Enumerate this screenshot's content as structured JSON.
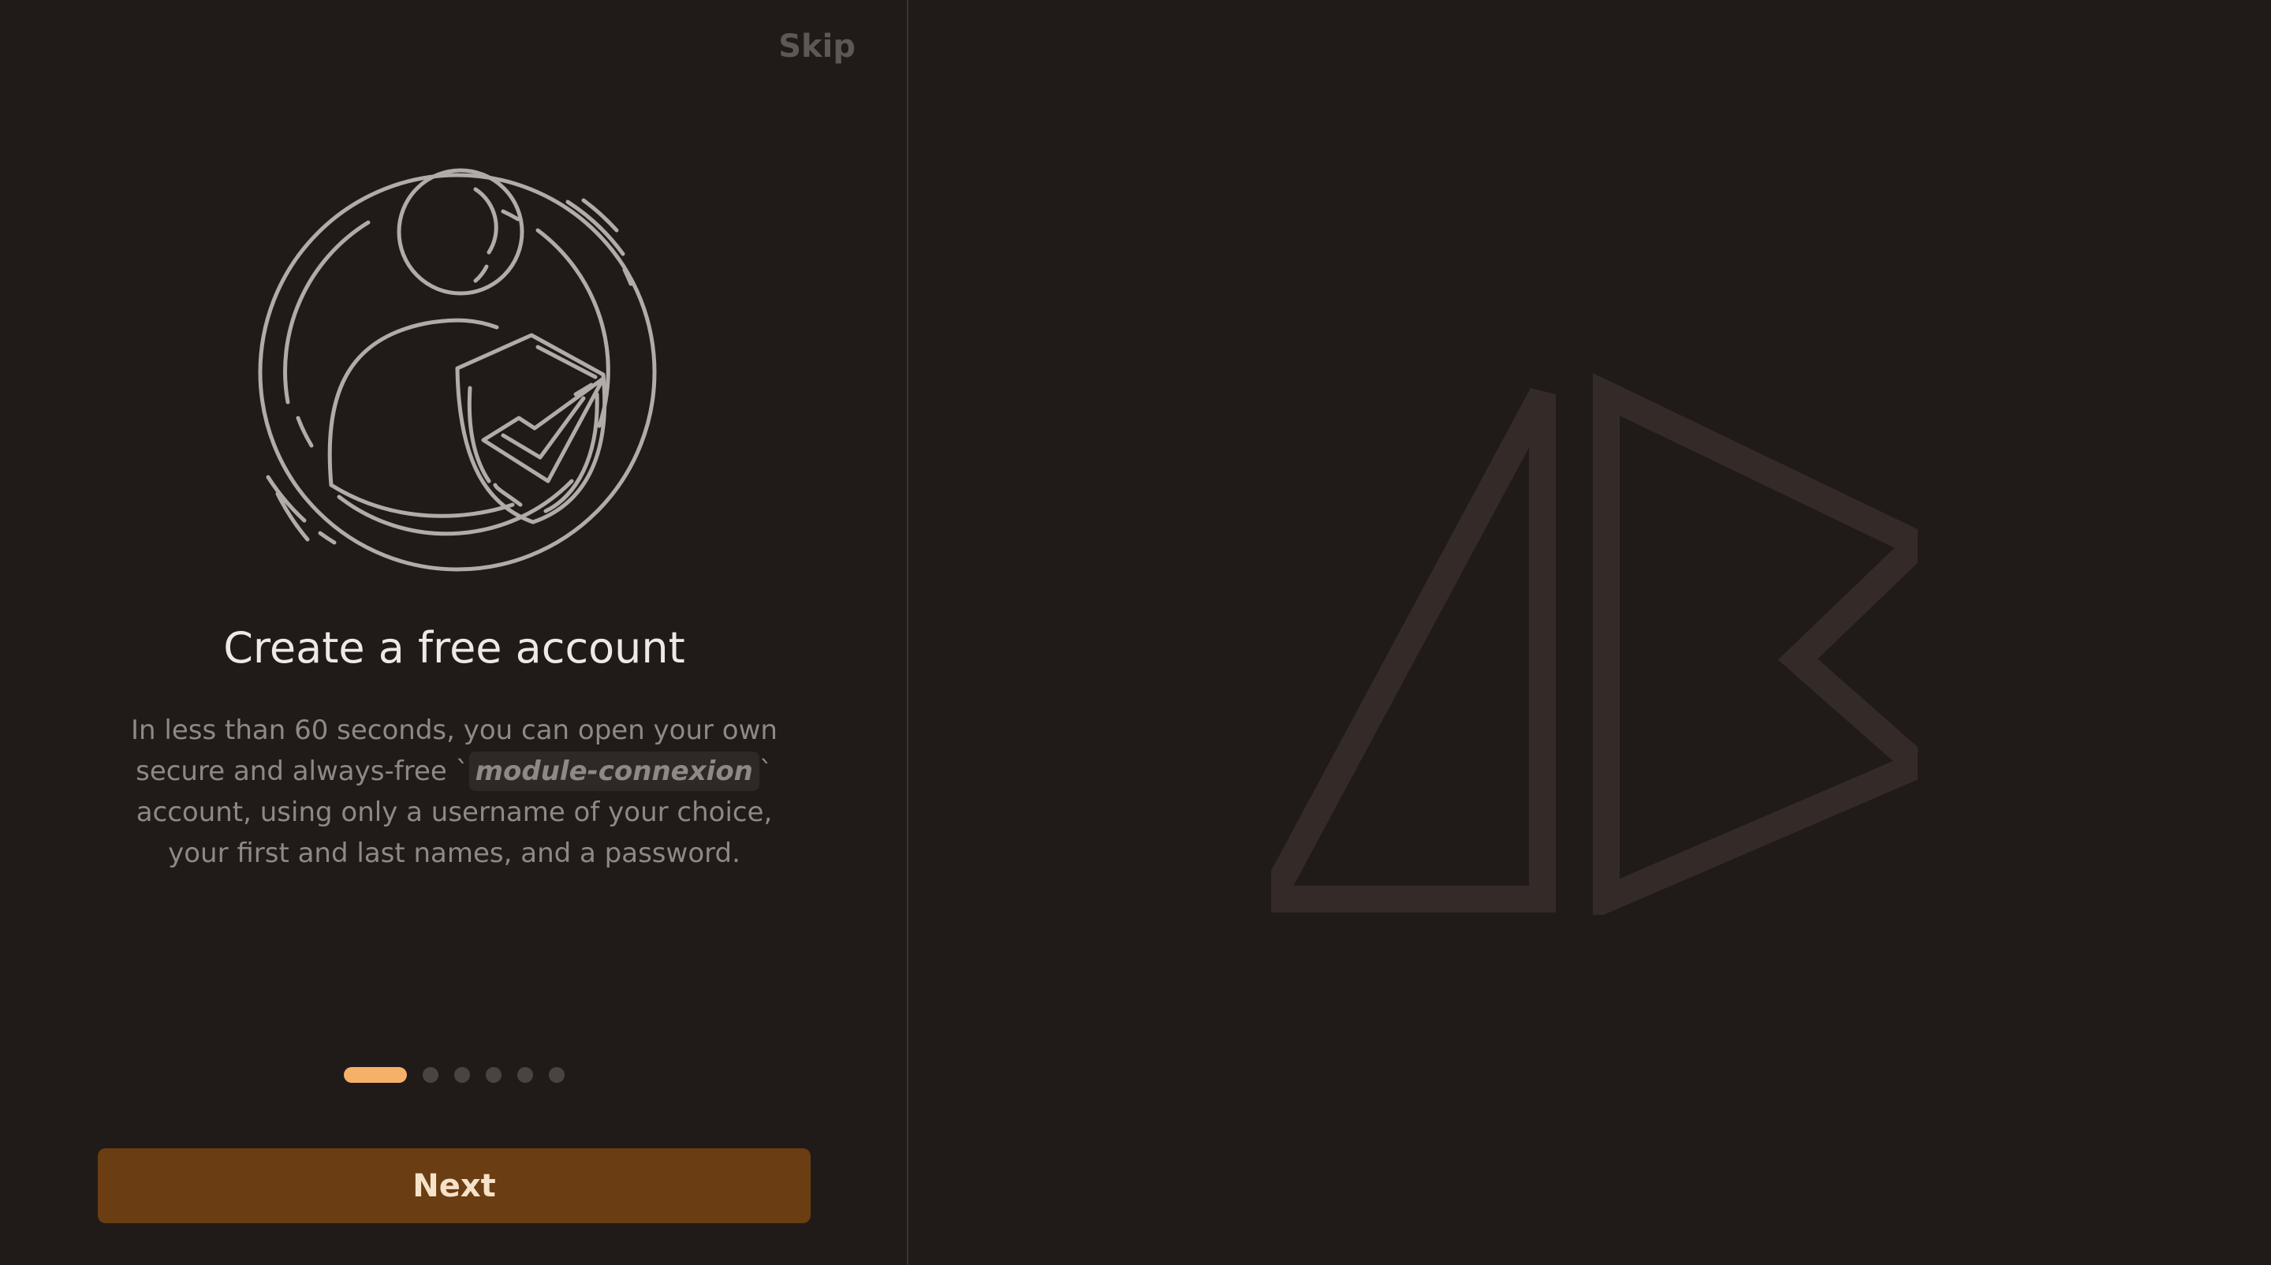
{
  "header": {
    "skip_label": "Skip"
  },
  "illustration": {
    "icon": "user-shield-check-icon"
  },
  "onboarding": {
    "title": "Create a free account",
    "description_before": "In less than 60 seconds, you can open your own secure and always-free `",
    "description_code": "module-connexion",
    "description_after": "` account, using only a username of your choice, your first and last names, and a password.",
    "current_step": 1,
    "total_steps": 6
  },
  "footer": {
    "next_label": "Next"
  },
  "brand": {
    "logo_icon": "ab-logo-icon"
  },
  "colors": {
    "background": "#201b18",
    "accent": "#f5b06a",
    "button": "#6b3d12",
    "button_text": "#f6e2c9",
    "logo": "#342b28"
  }
}
